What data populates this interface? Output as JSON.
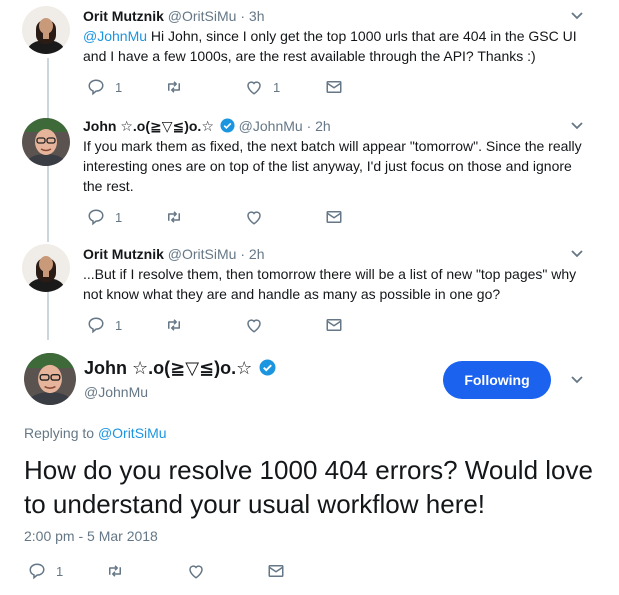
{
  "thread": [
    {
      "author": "Orit Mutznik",
      "handle": "@OritSiMu",
      "separator": "·",
      "time": "3h",
      "text_mention": "@JohnMu",
      "text": " Hi John, since I only get the top 1000 urls that are 404 in the GSC UI and I have a few 1000s, are the rest available through the API? Thanks :)",
      "reply_count": "1",
      "like_count": "1"
    },
    {
      "author": "John ☆.o(≧▽≦)o.☆",
      "handle": "@JohnMu",
      "separator": "·",
      "time": "2h",
      "verified": true,
      "text": "If you mark them as fixed, the next batch will appear \"tomorrow\". Since the really interesting ones are on top of the list anyway, I'd just focus on those and ignore the rest.",
      "reply_count": "1"
    },
    {
      "author": "Orit Mutznik",
      "handle": "@OritSiMu",
      "separator": "·",
      "time": "2h",
      "text": "...But if I resolve them, then tomorrow there will be a list of new \"top pages\" why not know what they are and handle as many as possible in one go?",
      "reply_count": "1"
    }
  ],
  "main_tweet": {
    "author": "John ☆.o(≧▽≦)o.☆",
    "handle": "@JohnMu",
    "verified": true,
    "follow_label": "Following",
    "replying_prefix": "Replying to ",
    "replying_to": "@OritSiMu",
    "text": "How do you resolve 1000 404 errors? Would love to understand your usual workflow here!",
    "timestamp": "2:00 pm - 5 Mar 2018",
    "reply_count": "1"
  },
  "icons": [
    "reply-icon",
    "retweet-icon",
    "like-icon",
    "dm-icon",
    "chevron-down-icon",
    "verified-badge-icon"
  ],
  "colors": {
    "accent": "#1b95e0",
    "follow_button": "#1b62ef",
    "muted": "#657786",
    "thread_line": "#ccd6dd"
  }
}
